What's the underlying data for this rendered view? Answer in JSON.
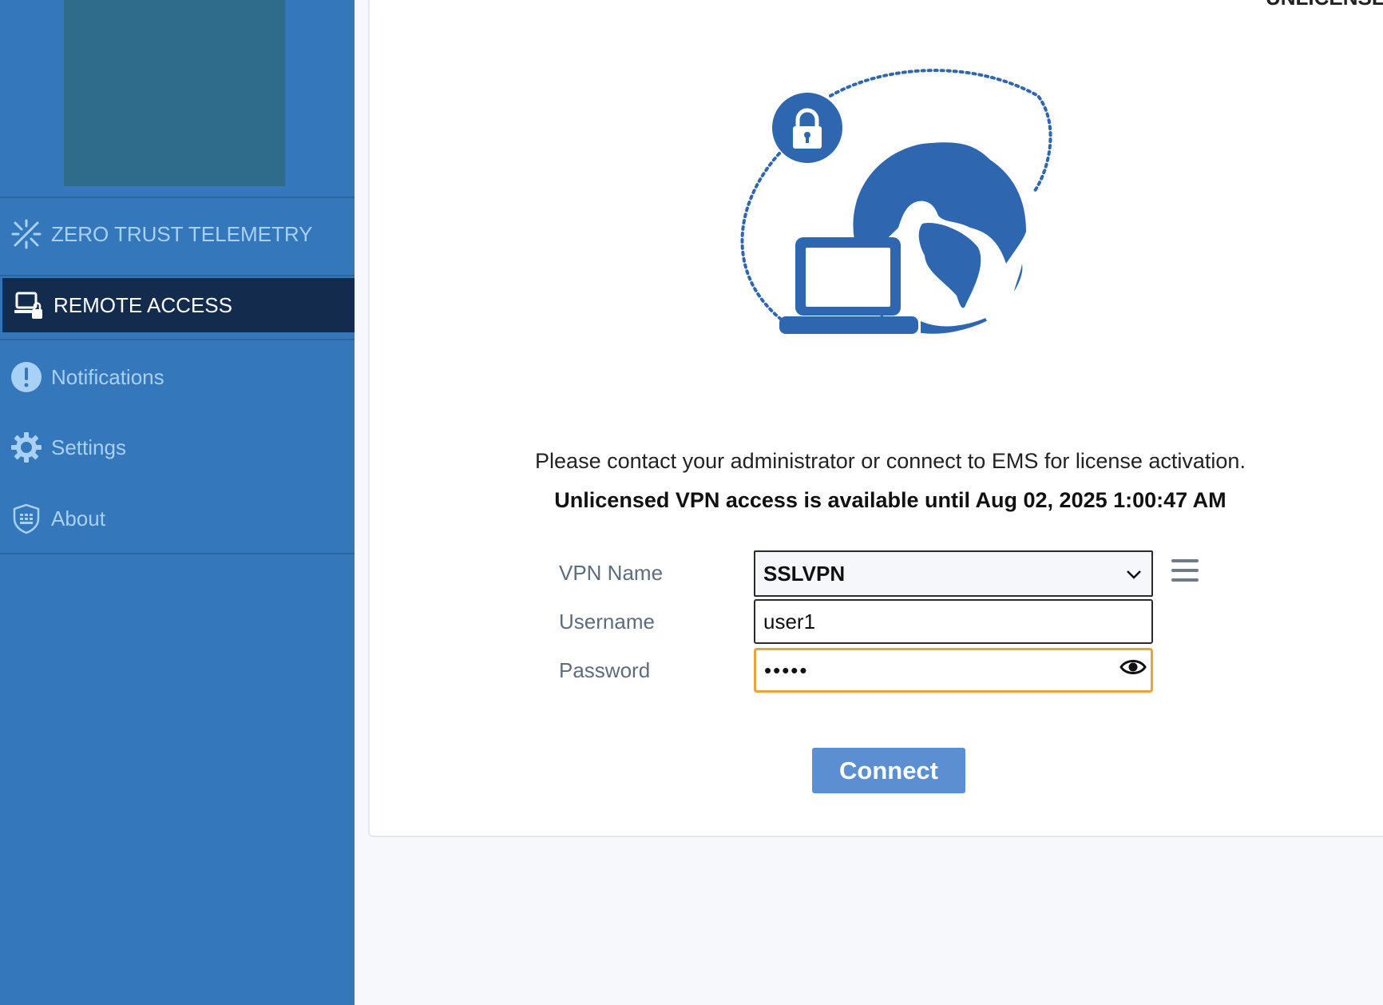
{
  "sidebar": {
    "items": [
      {
        "label": "ZERO TRUST TELEMETRY",
        "icon": "telemetry-icon",
        "active": false
      },
      {
        "label": "REMOTE ACCESS",
        "icon": "remote-access-icon",
        "active": true
      },
      {
        "label": "Notifications",
        "icon": "exclamation-icon",
        "active": false
      },
      {
        "label": "Settings",
        "icon": "gear-icon",
        "active": false
      },
      {
        "label": "About",
        "icon": "shield-info-icon",
        "active": false
      }
    ]
  },
  "header": {
    "corner_text": "UNLICENSED"
  },
  "main": {
    "message": "Please contact your administrator or connect to EMS for license activation.",
    "license_notice": "Unlicensed VPN access is available until Aug 02, 2025 1:00:47 AM",
    "form": {
      "vpn_name_label": "VPN Name",
      "vpn_name_value": "SSLVPN",
      "username_label": "Username",
      "username_value": "user1",
      "password_label": "Password",
      "password_value": "•••••"
    },
    "connect_label": "Connect"
  },
  "colors": {
    "sidebar_bg": "#3477ba",
    "active_item_bg": "#132c4e",
    "accent_blue": "#2f66b0",
    "button_bg": "#5b8fd2",
    "focus_border": "#e8a33a"
  }
}
